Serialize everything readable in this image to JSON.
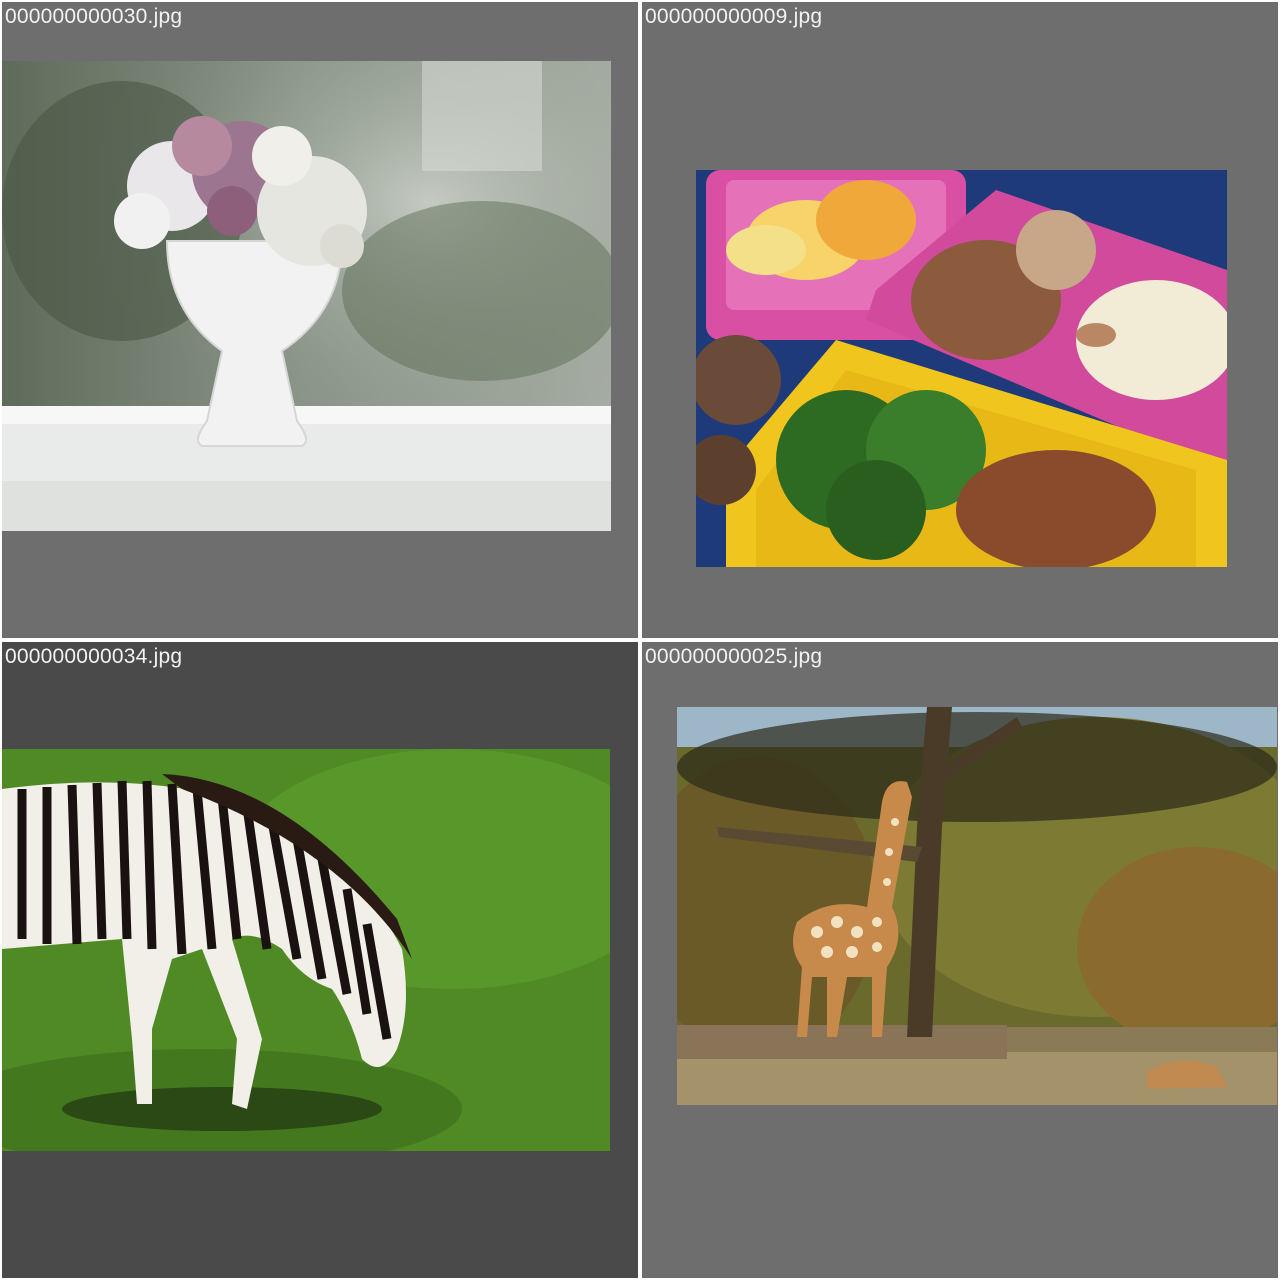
{
  "grid": {
    "cells": [
      {
        "filename": "000000000030.jpg",
        "subject": "white vase with flowers on railing",
        "background": "#6e6e6e"
      },
      {
        "filename": "000000000009.jpg",
        "subject": "bento lunch boxes with fruit, broccoli and bread",
        "background": "#6e6e6e"
      },
      {
        "filename": "000000000034.jpg",
        "subject": "zebra grazing on grass",
        "background": "#4a4a4a"
      },
      {
        "filename": "000000000025.jpg",
        "subject": "giraffe eating from tree",
        "background": "#6e6e6e"
      }
    ]
  },
  "colors": {
    "separator": "#ffffff",
    "caption_text": "#f2f2f2"
  }
}
